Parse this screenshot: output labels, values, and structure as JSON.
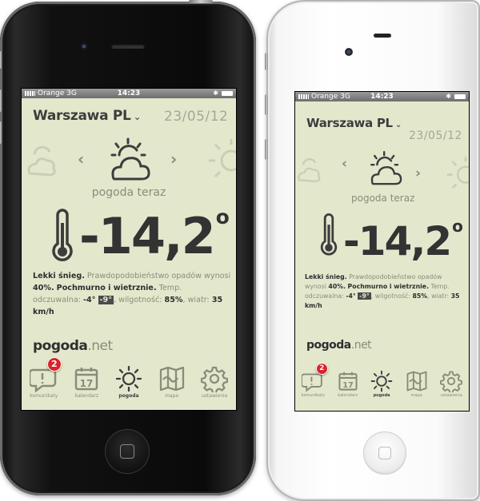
{
  "status_bar": {
    "carrier": "Orange 3G",
    "time": "14:23"
  },
  "location": {
    "city": "Warszawa PL",
    "chevron": "⌄",
    "date": "23/05/12"
  },
  "current": {
    "label": "pogoda teraz",
    "temperature": "-14,2",
    "degree": "o",
    "icon": "partly-cloudy-icon"
  },
  "description": {
    "summary": "Lekki śnieg.",
    "precip_text": "Prawdopodobieństwo opadów wynosi",
    "precip_value": "40%.",
    "wind_summary": "Pochmurno i wietrznie.",
    "feels_label": "Temp. odczuwalna:",
    "feels_value": "-4°",
    "feels_alt": "-9°",
    "humidity_label": ", wilgotność:",
    "humidity_value": "85%",
    "wind_label": ", wiatr:",
    "wind_value": "35 km/h"
  },
  "brand": {
    "name": "pogoda",
    "suffix": ".net"
  },
  "tabs": [
    {
      "id": "komunikaty",
      "label": "komunikaty",
      "icon": "speech-bubble-alert-icon",
      "badge": "2",
      "active": false
    },
    {
      "id": "kalendarz",
      "label": "kalendarz",
      "icon": "calendar-icon",
      "day": "17",
      "active": false
    },
    {
      "id": "pogoda",
      "label": "pogoda",
      "icon": "sun-icon",
      "active": true
    },
    {
      "id": "mapa",
      "label": "mapa",
      "icon": "map-icon",
      "active": false
    },
    {
      "id": "ustawienia",
      "label": "ustawienia",
      "icon": "gear-icon",
      "active": false
    }
  ],
  "colors": {
    "screen_bg": "#e3e8cd",
    "text_dark": "#2d2d2d",
    "text_muted": "#8a8c78",
    "badge": "#d8232a"
  }
}
